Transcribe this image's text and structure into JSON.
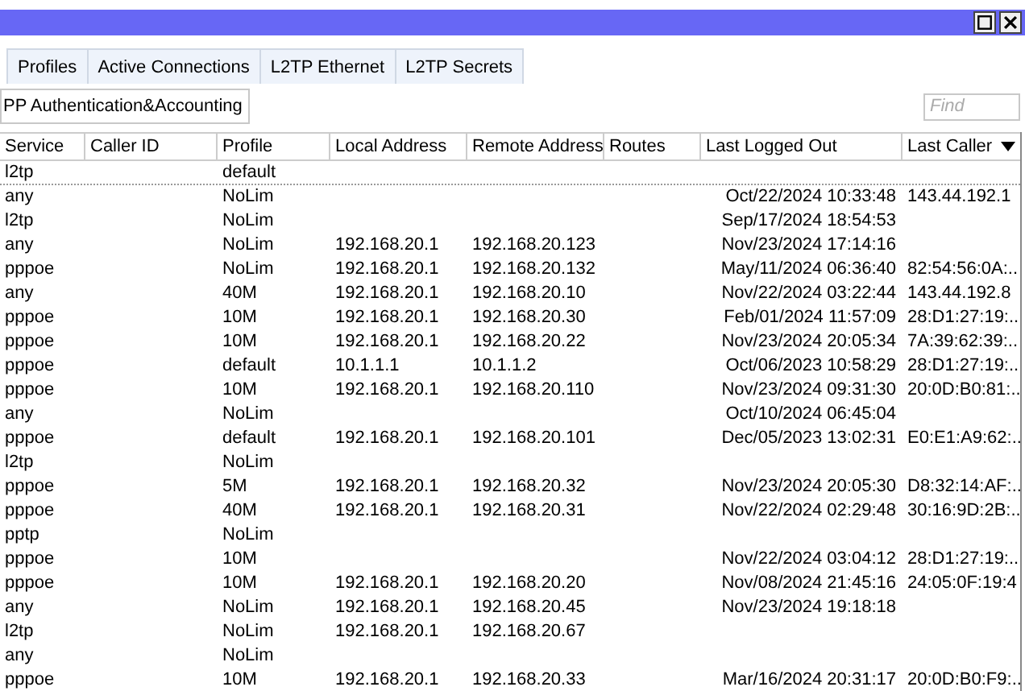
{
  "tabs": [
    {
      "label": "Profiles",
      "selected": false
    },
    {
      "label": "Active Connections",
      "selected": false
    },
    {
      "label": "L2TP Ethernet",
      "selected": false
    },
    {
      "label": "L2TP Secrets",
      "selected": false
    }
  ],
  "toolbar": {
    "button": "PP Authentication&Accounting",
    "search": {
      "placeholder": "Find"
    }
  },
  "table": {
    "columns": [
      "Service",
      "Caller ID",
      "Profile",
      "Local Address",
      "Remote Address",
      "Routes",
      "Last Logged Out",
      "Last Caller"
    ],
    "rows": [
      {
        "service": "l2tp",
        "profile": "default"
      },
      {
        "service": "any",
        "profile": "NoLim",
        "last_logged_out": "Oct/22/2024 10:33:48",
        "last_caller": "143.44.192.1"
      },
      {
        "service": "l2tp",
        "profile": "NoLim",
        "last_logged_out": "Sep/17/2024 18:54:53"
      },
      {
        "service": "any",
        "profile": "NoLim",
        "local_address": "192.168.20.1",
        "remote_address": "192.168.20.123",
        "last_logged_out": "Nov/23/2024 17:14:16"
      },
      {
        "service": "pppoe",
        "profile": "NoLim",
        "local_address": "192.168.20.1",
        "remote_address": "192.168.20.132",
        "last_logged_out": "May/11/2024 06:36:40",
        "last_caller": "82:54:56:0A:.."
      },
      {
        "service": "any",
        "profile": "40M",
        "local_address": "192.168.20.1",
        "remote_address": "192.168.20.10",
        "last_logged_out": "Nov/22/2024 03:22:44",
        "last_caller": "143.44.192.8"
      },
      {
        "service": "pppoe",
        "profile": "10M",
        "local_address": "192.168.20.1",
        "remote_address": "192.168.20.30",
        "last_logged_out": "Feb/01/2024 11:57:09",
        "last_caller": "28:D1:27:19:.."
      },
      {
        "service": "pppoe",
        "profile": "10M",
        "local_address": "192.168.20.1",
        "remote_address": "192.168.20.22",
        "last_logged_out": "Nov/23/2024 20:05:34",
        "last_caller": "7A:39:62:39:.."
      },
      {
        "service": "pppoe",
        "profile": "default",
        "local_address": "10.1.1.1",
        "remote_address": "10.1.1.2",
        "last_logged_out": "Oct/06/2023 10:58:29",
        "last_caller": "28:D1:27:19:.."
      },
      {
        "service": "pppoe",
        "profile": "10M",
        "local_address": "192.168.20.1",
        "remote_address": "192.168.20.110",
        "last_logged_out": "Nov/23/2024 09:31:30",
        "last_caller": "20:0D:B0:81:.."
      },
      {
        "service": "any",
        "profile": "NoLim",
        "last_logged_out": "Oct/10/2024 06:45:04"
      },
      {
        "service": "pppoe",
        "profile": "default",
        "local_address": "192.168.20.1",
        "remote_address": "192.168.20.101",
        "last_logged_out": "Dec/05/2023 13:02:31",
        "last_caller": "E0:E1:A9:62:.."
      },
      {
        "service": "l2tp",
        "profile": "NoLim"
      },
      {
        "service": "pppoe",
        "profile": "5M",
        "local_address": "192.168.20.1",
        "remote_address": "192.168.20.32",
        "last_logged_out": "Nov/23/2024 20:05:30",
        "last_caller": "D8:32:14:AF:.."
      },
      {
        "service": "pppoe",
        "profile": "40M",
        "local_address": "192.168.20.1",
        "remote_address": "192.168.20.31",
        "last_logged_out": "Nov/22/2024 02:29:48",
        "last_caller": "30:16:9D:2B:.."
      },
      {
        "service": "pptp",
        "profile": "NoLim"
      },
      {
        "service": "pppoe",
        "profile": "10M",
        "last_logged_out": "Nov/22/2024 03:04:12",
        "last_caller": "28:D1:27:19:.."
      },
      {
        "service": "pppoe",
        "profile": "10M",
        "local_address": "192.168.20.1",
        "remote_address": "192.168.20.20",
        "last_logged_out": "Nov/08/2024 21:45:16",
        "last_caller": "24:05:0F:19:4"
      },
      {
        "service": "any",
        "profile": "NoLim",
        "local_address": "192.168.20.1",
        "remote_address": "192.168.20.45",
        "last_logged_out": "Nov/23/2024 19:18:18"
      },
      {
        "service": "l2tp",
        "profile": "NoLim",
        "local_address": "192.168.20.1",
        "remote_address": "192.168.20.67"
      },
      {
        "service": "any",
        "profile": "NoLim"
      },
      {
        "service": "pppoe",
        "profile": "10M",
        "local_address": "192.168.20.1",
        "remote_address": "192.168.20.33",
        "last_logged_out": "Mar/16/2024 20:31:17",
        "last_caller": "20:0D:B0:F9:.."
      }
    ]
  }
}
